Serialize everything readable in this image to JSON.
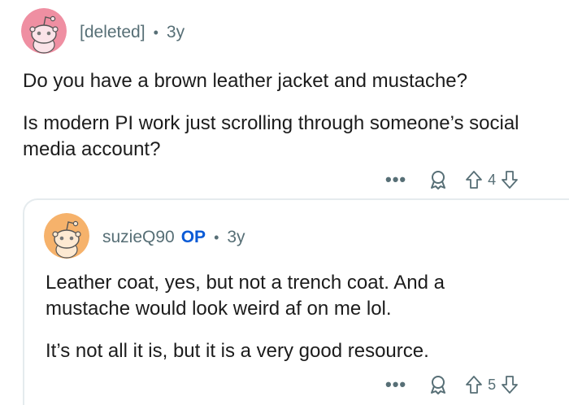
{
  "comments": [
    {
      "user": "[deleted]",
      "is_op": false,
      "op_label": "",
      "separator": "•",
      "age": "3y",
      "paragraphs": [
        "Do you have a brown leather jacket and mustache?",
        "Is modern PI work just scrolling through someone’s social media account?"
      ],
      "more_label": "•••",
      "vote_count": "4",
      "avatar_color": "#ef8fa2"
    },
    {
      "user": "suzieQ90",
      "is_op": true,
      "op_label": "OP",
      "separator": "•",
      "age": "3y",
      "paragraphs": [
        "Leather coat, yes, but not a trench coat. And a mustache would look weird af on me lol.",
        "It’s not all it is, but it is a very good resource."
      ],
      "more_label": "•••",
      "vote_count": "5",
      "avatar_color": "#f6b26b"
    }
  ],
  "colors": {
    "meta": "#576f76",
    "op": "#0a5ad6",
    "text": "#1c1c1c",
    "thread": "#e5ebee"
  },
  "icons": [
    "snoo-avatar-icon",
    "award-icon",
    "upvote-icon",
    "downvote-icon",
    "more-icon"
  ]
}
